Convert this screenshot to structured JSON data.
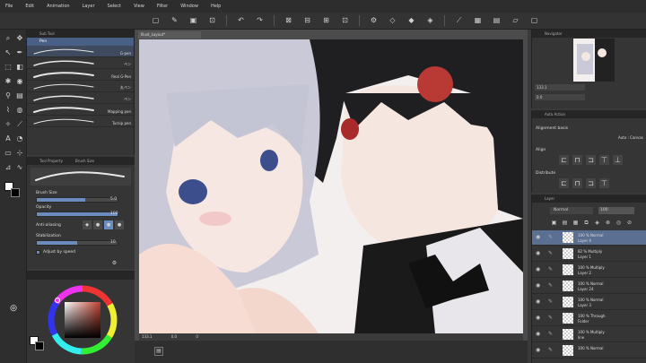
{
  "menu": [
    "File",
    "Edit",
    "Animation",
    "Layer",
    "Select",
    "View",
    "Filter",
    "Window",
    "Help"
  ],
  "subtool": {
    "tab1": "Sub Tool",
    "group": "Pen",
    "brushes": [
      "G-pen",
      "ペン",
      "Real G-Pen",
      "丸ペン",
      "ペン",
      "Mapping pen",
      "Turnip pen"
    ]
  },
  "toolprop": {
    "tab1": "Tool Property",
    "tab2": "Brush Size",
    "brush_size_label": "Brush Size",
    "brush_size_value": "5.0",
    "opacity_label": "Opacity",
    "opacity_value": "100",
    "antialias_label": "Anti-aliasing",
    "stabilization_label": "Stabilization",
    "stabilization_value": "10",
    "adjust_label": "Adjust by speed",
    "brush_size_fill": 0.6,
    "opacity_fill": 1.0,
    "stab_fill": 0.5
  },
  "color": {
    "hue_marker": "#a83a32",
    "main": "#ffffff",
    "sub": "#000000"
  },
  "canvas": {
    "doc_tab": "Illust_Layout*",
    "zoom": "133.1",
    "status_a": "0.0",
    "status_b": "0"
  },
  "navigator": {
    "tab": "Navigator",
    "zoom": "133.1",
    "angle": "0.0"
  },
  "subview": {
    "tab": "Auto Action",
    "panel": "Alignment basis",
    "mode": "Auto : Canvas",
    "align": "Align",
    "distribute": "Distribute"
  },
  "layers": {
    "tab": "Layer",
    "blend": "Normal",
    "opacity": "100",
    "rows": [
      {
        "l1": "100 % Normal",
        "l2": "Layer 4",
        "selected": true
      },
      {
        "l1": "82 % Multiply",
        "l2": "Layer 1",
        "selected": false
      },
      {
        "l1": "100 % Multiply",
        "l2": "Layer 2",
        "selected": false
      },
      {
        "l1": "100 % Normal",
        "l2": "Layer 24",
        "selected": false
      },
      {
        "l1": "100 % Normal",
        "l2": "Layer 3",
        "selected": false
      },
      {
        "l1": "100 % Through",
        "l2": "Folder",
        "selected": false
      },
      {
        "l1": "100 % Multiply",
        "l2": "line",
        "selected": false
      },
      {
        "l1": "100 % Normal",
        "l2": "",
        "selected": false
      }
    ]
  }
}
